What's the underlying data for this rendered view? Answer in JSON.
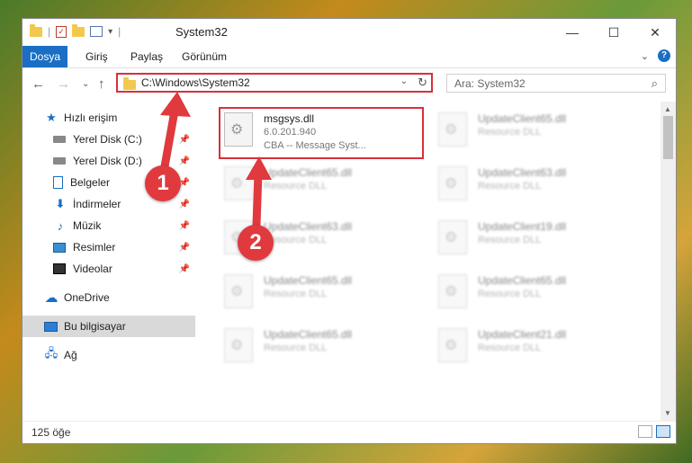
{
  "window": {
    "title": "System32"
  },
  "ribbon": {
    "tabs": [
      {
        "label": "Dosya"
      },
      {
        "label": "Giriş"
      },
      {
        "label": "Paylaş"
      },
      {
        "label": "Görünüm"
      }
    ]
  },
  "address": {
    "path": "C:\\Windows\\System32"
  },
  "search": {
    "placeholder": "Ara: System32"
  },
  "sidebar": {
    "quick_access": "Hızlı erişim",
    "items": [
      {
        "label": "Yerel Disk (C:)"
      },
      {
        "label": "Yerel Disk (D:)"
      },
      {
        "label": "Belgeler"
      },
      {
        "label": "İndirmeler"
      },
      {
        "label": "Müzik"
      },
      {
        "label": "Resimler"
      },
      {
        "label": "Videolar"
      }
    ],
    "onedrive": "OneDrive",
    "this_pc": "Bu bilgisayar",
    "network": "Ağ"
  },
  "files": {
    "main": {
      "name": "msgsys.dll",
      "version": "6.0.201.940",
      "description": "CBA -- Message Syst..."
    },
    "blurred": [
      {
        "name": "UpdateClient65.dll",
        "type": "Resource DLL"
      },
      {
        "name": "UpdateClient65.dll",
        "type": "Resource DLL"
      },
      {
        "name": "UpdateClient63.dll",
        "type": "Resource DLL"
      },
      {
        "name": "UpdateClient63.dll",
        "type": "Resource DLL"
      },
      {
        "name": "UpdateClient19.dll",
        "type": "Resource DLL"
      },
      {
        "name": "UpdateClient65.dll",
        "type": "Resource DLL"
      },
      {
        "name": "UpdateClient65.dll",
        "type": "Resource DLL"
      },
      {
        "name": "UpdateClient65.dll",
        "type": "Resource DLL"
      },
      {
        "name": "UpdateClient21.dll",
        "type": "Resource DLL"
      }
    ]
  },
  "status": {
    "count": "125 öğe"
  },
  "annotations": {
    "one": "1",
    "two": "2"
  },
  "colors": {
    "accent": "#1a6fc4",
    "highlight": "#d9303a"
  }
}
